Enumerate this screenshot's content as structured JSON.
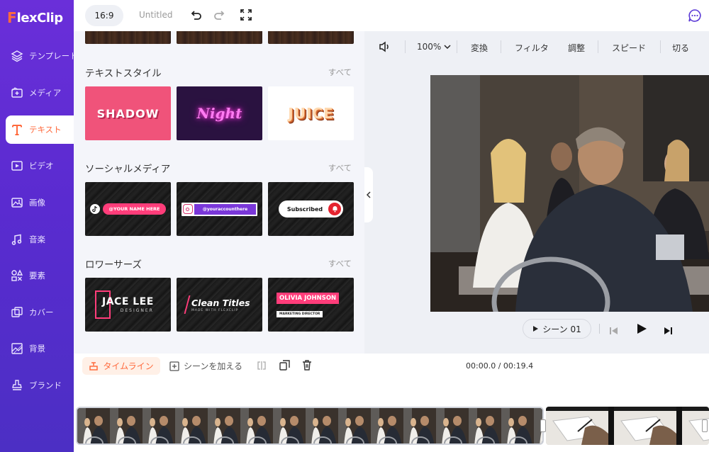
{
  "app": {
    "logo_mark": "F",
    "logo_text": "lexClip"
  },
  "sidebar": {
    "items": [
      {
        "label": "テンプレート",
        "icon": "layers-icon"
      },
      {
        "label": "メディア",
        "icon": "media-add-icon"
      },
      {
        "label": "テキスト",
        "icon": "text-icon",
        "active": true
      },
      {
        "label": "ビデオ",
        "icon": "video-icon"
      },
      {
        "label": "画像",
        "icon": "image-icon"
      },
      {
        "label": "音楽",
        "icon": "music-icon"
      },
      {
        "label": "要素",
        "icon": "elements-icon"
      },
      {
        "label": "カバー",
        "icon": "cover-icon"
      },
      {
        "label": "背景",
        "icon": "background-icon"
      },
      {
        "label": "ブランド",
        "icon": "brand-icon"
      }
    ]
  },
  "topbar": {
    "ratio": "16:9",
    "title": "Untitled"
  },
  "panel": {
    "sections": [
      {
        "title": "テキストスタイル",
        "see_all": "すべて",
        "tiles": [
          {
            "text": "SHADOW"
          },
          {
            "text": "Night"
          },
          {
            "text": "JUICE"
          }
        ]
      },
      {
        "title": "ソーシャルメディア",
        "see_all": "すべて",
        "tiles": [
          {
            "text": "@YOUR NAME HERE"
          },
          {
            "text": "@youraccounthere"
          },
          {
            "text": "Subscribed"
          }
        ]
      },
      {
        "title": "ロワーサーズ",
        "see_all": "すべて",
        "tiles": [
          {
            "text": "JACE LEE",
            "sub": "DESIGNER"
          },
          {
            "text": "Clean Titles",
            "sub": "MADE WITH FLEXCLIP"
          },
          {
            "text": "OLIVIA JOHNSON",
            "sub": "MARKETING DIRECTOR"
          }
        ]
      }
    ]
  },
  "preview_toolbar": {
    "zoom": "100%",
    "transform": "変換",
    "filter": "フィルタ",
    "adjust": "調整",
    "speed": "スピード",
    "cut": "切る"
  },
  "player": {
    "scene_label": "シーン 01"
  },
  "timeline": {
    "button": "タイムライン",
    "add_scene": "シーンを加える",
    "time": "00:00.0 / 00:19.4"
  },
  "colors": {
    "accent": "#ff6a3d",
    "sidebar": "#5a2bd0",
    "panel_bg": "#f4f5fa"
  }
}
